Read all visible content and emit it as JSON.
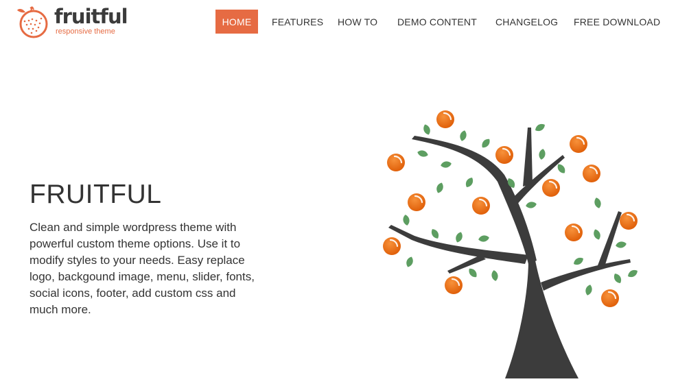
{
  "logo": {
    "wordmark": "fruitful",
    "tagline": "responsive theme"
  },
  "nav": {
    "items": [
      {
        "label": "HOME",
        "active": true
      },
      {
        "label": "FEATURES",
        "active": false
      },
      {
        "label": "HOW TO",
        "active": false
      },
      {
        "label": "DEMO CONTENT",
        "active": false
      },
      {
        "label": "CHANGELOG",
        "active": false
      },
      {
        "label": "FREE DOWNLOAD",
        "active": false
      }
    ]
  },
  "hero": {
    "title": "FRUITFUL",
    "description": "Clean and simple wordpress theme with powerful custom theme options. Use it to modify styles to your needs. Easy replace logo, backgound image, menu, slider, fonts, social icons, footer, add custom css and much more."
  },
  "colors": {
    "accent": "#e66b43",
    "text": "#333333",
    "trunk": "#3c3c3c",
    "fruit": "#ec6a0c",
    "leaf": "#5d9e61"
  },
  "icons": {
    "logo": "orange-fruit-icon",
    "illustration": "orange-tree-illustration"
  }
}
